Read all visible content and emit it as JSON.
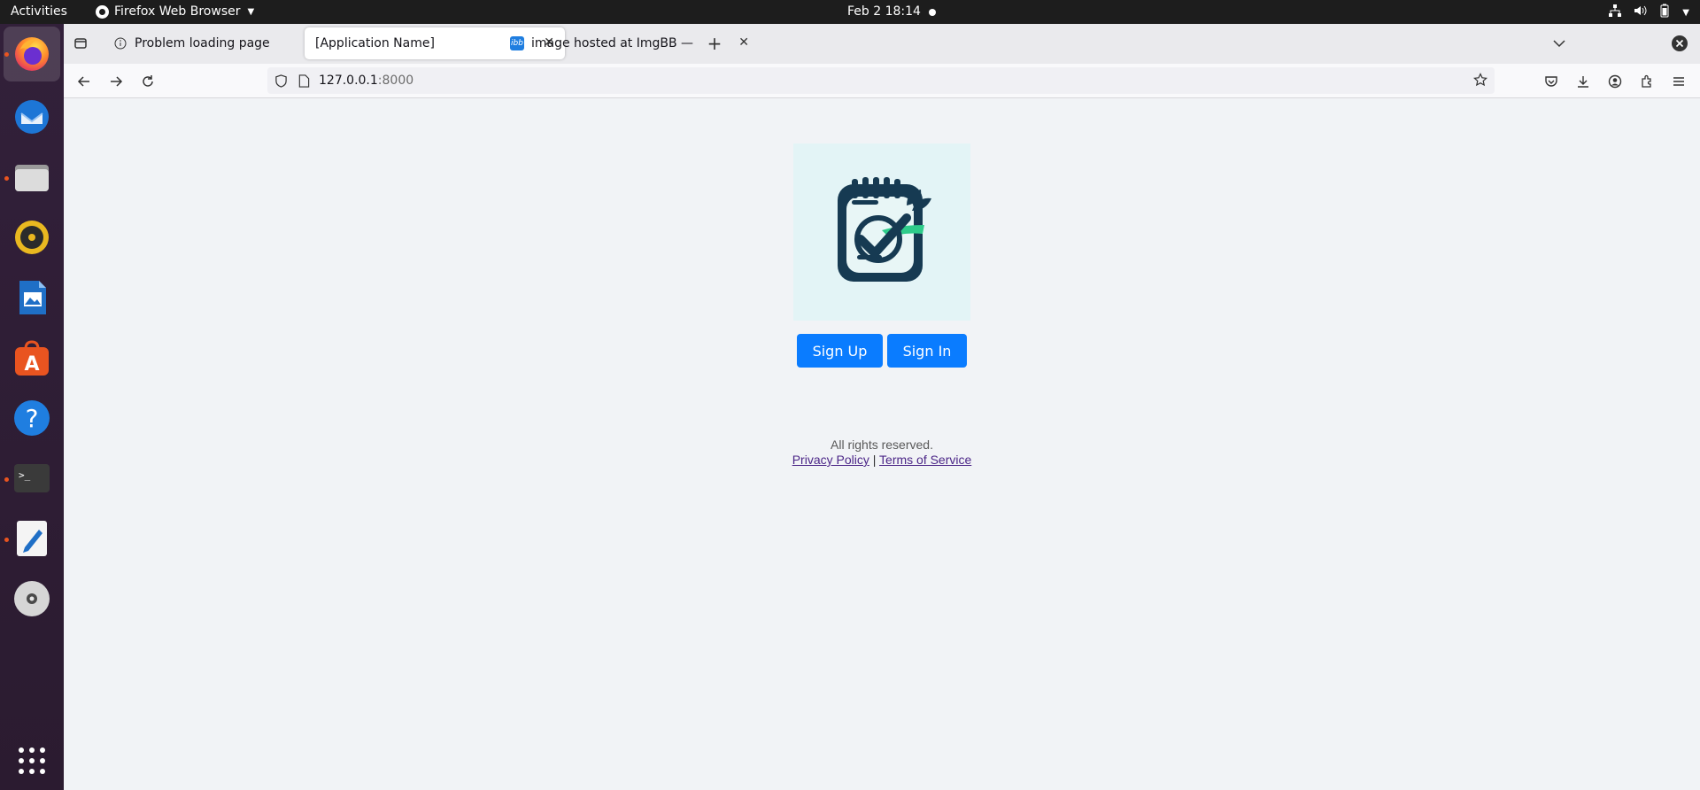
{
  "system_bar": {
    "activities": "Activities",
    "app_name": "Firefox Web Browser",
    "clock": "Feb 2  18:14"
  },
  "dock": {
    "items": [
      "firefox-icon",
      "thunderbird-icon",
      "files-icon",
      "rhythmbox-icon",
      "writer-icon",
      "app-center-icon",
      "help-icon",
      "terminal-icon",
      "text-editor-icon",
      "disc-icon",
      "show-apps-icon"
    ]
  },
  "browser": {
    "tabs": [
      {
        "title": "Problem loading page"
      },
      {
        "title": "[Application Name]"
      },
      {
        "title": "image hosted at ImgBB —"
      }
    ],
    "url_host": "127.0.0.1",
    "url_port": ":8000"
  },
  "page": {
    "sign_up": "Sign Up",
    "sign_in": "Sign In",
    "footer_text": "All rights reserved.",
    "privacy_link": "Privacy Policy",
    "separator": "|",
    "terms_link": "Terms of Service"
  },
  "colors": {
    "primary_button": "#0a7cff",
    "logo_bg": "#e3f4f6",
    "logo_dark": "#163a52",
    "logo_green": "#2ecc8a",
    "dock_bg": "#2d1d32"
  }
}
